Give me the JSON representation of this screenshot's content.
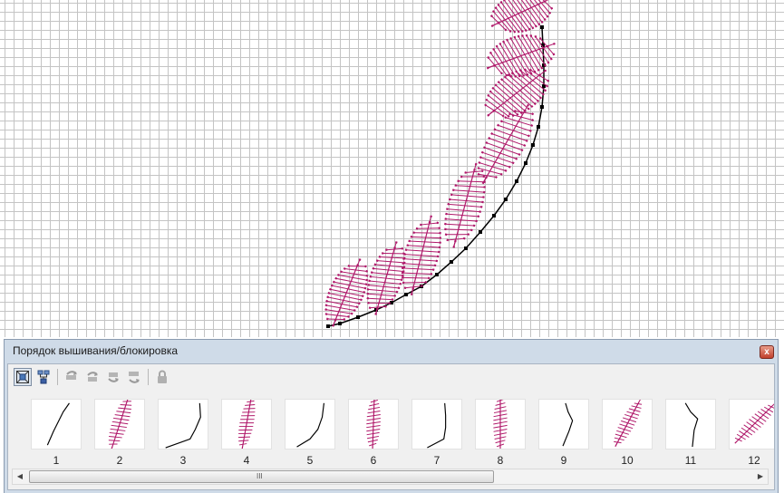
{
  "panel": {
    "title": "Порядок вышивания/блокировка",
    "close_glyph": "x",
    "toolbar": [
      {
        "icon": "fit-to-view-icon",
        "enabled": true
      },
      {
        "icon": "group-objects-icon",
        "enabled": true
      },
      {
        "icon": "move-first-icon",
        "enabled": false
      },
      {
        "icon": "move-up-icon",
        "enabled": false
      },
      {
        "icon": "move-down-icon",
        "enabled": false
      },
      {
        "icon": "move-last-icon",
        "enabled": false
      },
      {
        "icon": "lock-icon",
        "enabled": false
      }
    ],
    "thumbnails": [
      {
        "number": "1",
        "kind": "line"
      },
      {
        "number": "2",
        "kind": "leaf"
      },
      {
        "number": "3",
        "kind": "line"
      },
      {
        "number": "4",
        "kind": "leaf"
      },
      {
        "number": "5",
        "kind": "line"
      },
      {
        "number": "6",
        "kind": "leaf"
      },
      {
        "number": "7",
        "kind": "line"
      },
      {
        "number": "8",
        "kind": "leaf"
      },
      {
        "number": "9",
        "kind": "line"
      },
      {
        "number": "10",
        "kind": "leaf"
      },
      {
        "number": "11",
        "kind": "line"
      },
      {
        "number": "12",
        "kind": "leaf"
      }
    ],
    "scrollbar": {
      "left_arrow": "◀",
      "right_arrow": "▶",
      "grip": "III"
    }
  },
  "colors": {
    "thread": "#b0186a",
    "stem": "#000000",
    "panel_bg": "#cfdbe8"
  }
}
